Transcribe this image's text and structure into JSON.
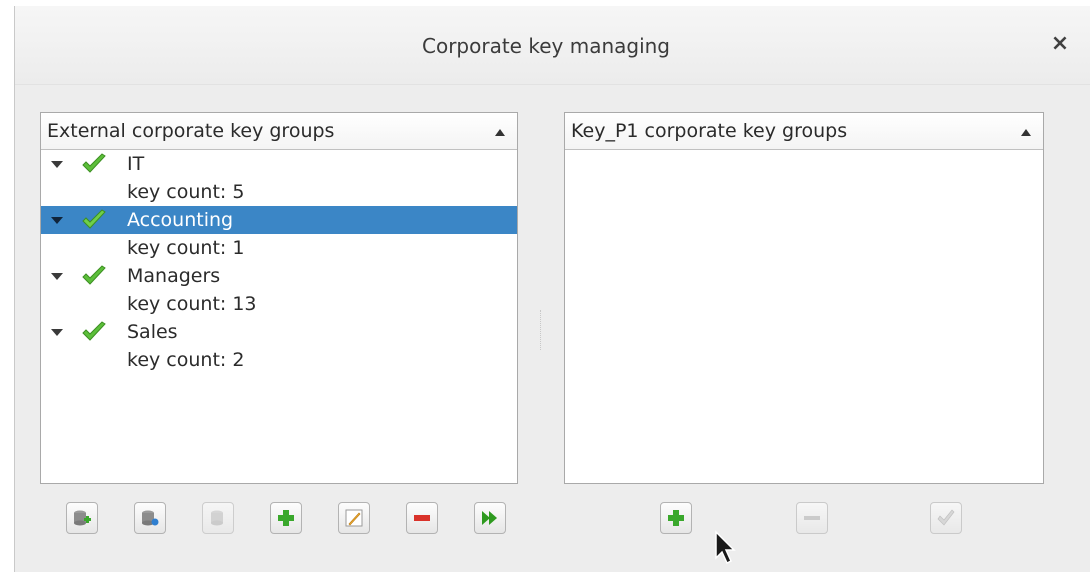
{
  "dialog": {
    "title": "Corporate key managing",
    "close_label": "×"
  },
  "left_panel": {
    "header": "External corporate key groups",
    "groups": [
      {
        "name": "IT",
        "detail": "key count: 5",
        "selected": false
      },
      {
        "name": "Accounting",
        "detail": "key count: 1",
        "selected": true
      },
      {
        "name": "Managers",
        "detail": "key count: 13",
        "selected": false
      },
      {
        "name": "Sales",
        "detail": "key count: 2",
        "selected": false
      }
    ],
    "buttons": [
      {
        "icon": "database-add-icon",
        "enabled": true
      },
      {
        "icon": "database-import-icon",
        "enabled": true
      },
      {
        "icon": "database-disabled-icon",
        "enabled": false
      },
      {
        "icon": "plus-icon",
        "enabled": true
      },
      {
        "icon": "pencil-icon",
        "enabled": true
      },
      {
        "icon": "minus-icon",
        "enabled": true
      },
      {
        "icon": "forward-icon",
        "enabled": true
      }
    ]
  },
  "right_panel": {
    "header": "Key_P1 corporate key groups",
    "buttons": [
      {
        "icon": "plus-icon",
        "enabled": true
      },
      {
        "icon": "minus-icon",
        "enabled": false
      },
      {
        "icon": "checkmark-icon",
        "enabled": false
      }
    ]
  },
  "colors": {
    "selection": "#3b86c6",
    "check_green": "#5cbf3a",
    "plus_green": "#3aa82c",
    "minus_red": "#d9322a"
  }
}
